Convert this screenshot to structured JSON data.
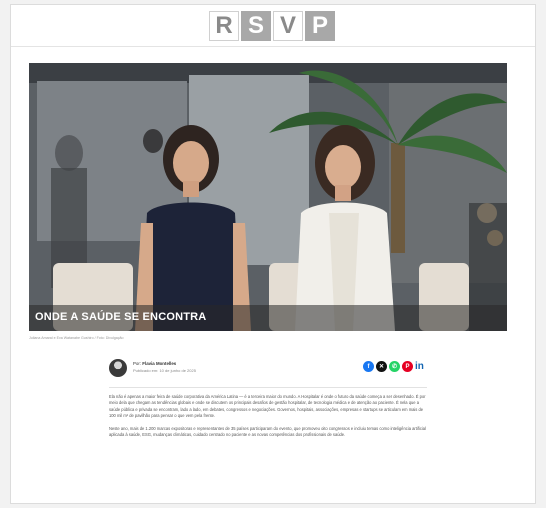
{
  "site": {
    "logo_letters": [
      "R",
      "S",
      "V",
      "P"
    ]
  },
  "article": {
    "title": "ONDE A SAÚDE SE ENCONTRA",
    "photo_caption": "Juliana Amaral e Eva Watanabe Gushiro / Foto: Divulgação",
    "author_prefix": "Por:",
    "author_name": "Flavia Montelles",
    "published": "Publicado em: 10 de junho de 2025",
    "paragraphs": [
      "Ela não é apenas a maior feira de saúde corporativa da América Latina — é a terceira maior do mundo. A Hospitalar é onde o futuro da saúde começa a ser desenhado. É por meio dela que chegam as tendências globais e onde se discutem os principais desafios de gestão hospitalar, de tecnologia médica e de atenção ao paciente. É nela que a saúde pública e privada se encontram, lado a lado, em debates, congressos e negociações. Governos, hospitais, associações, empresas e startups se articulam em mais de 100 mil m² de pavilhão para pensar o que vem pela frente.",
      "Neste ano, mais de 1.200 marcas expositoras e representantes de 35 países participaram do evento, que promoveu oito congressos e incluiu temas como inteligência artificial aplicada à saúde, ESG, mudanças climáticas, cuidado centrado no paciente e as novas competências dos profissionais de saúde."
    ]
  },
  "share_icons": [
    {
      "name": "facebook-icon",
      "glyph": "f",
      "color": "#1877f2"
    },
    {
      "name": "x-icon",
      "glyph": "✕",
      "color": "#111111"
    },
    {
      "name": "whatsapp-icon",
      "glyph": "✆",
      "color": "#25d366"
    },
    {
      "name": "pinterest-icon",
      "glyph": "P",
      "color": "#e60023"
    }
  ],
  "share_linkedin": "in"
}
